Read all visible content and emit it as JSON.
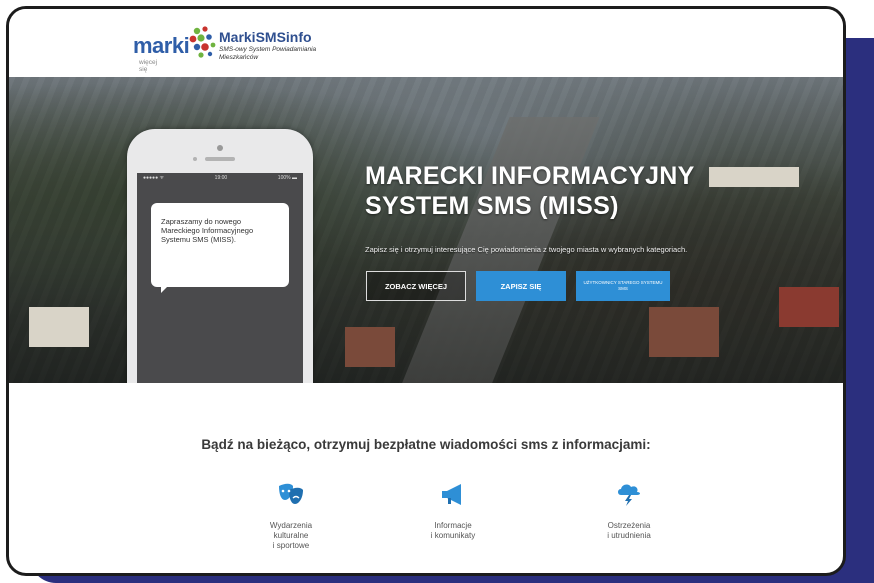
{
  "brand": {
    "logo_word": "marki",
    "logo_tagline": "więcej się",
    "title": "MarkiSMSinfo",
    "subtitle": "SMS-owy System Powiadamiania Mieszkańców"
  },
  "phone": {
    "status_left": "●●●●● ᯤ",
    "status_time": "19:00",
    "status_right": "100% ▬",
    "message": "Zapraszamy do nowego Mareckiego Informacyjnego Systemu SMS (MISS)."
  },
  "hero": {
    "title_line1": "MARECKI INFORMACYJNY",
    "title_line2": "SYSTEM SMS (MISS)",
    "subtitle": "Zapisz się i otrzymuj interesujące Cię powiadomienia z twojego miasta w wybranych kategoriach.",
    "btn_more": "ZOBACZ WIĘCEJ",
    "btn_signup": "ZAPISZ SIĘ",
    "btn_users": "UŻYTKOWNICY STAREGO SYSTEMU SMS"
  },
  "info": {
    "lead": "Bądź na bieżąco, otrzymuj bezpłatne wiadomości sms z informacjami:",
    "features": [
      {
        "icon": "theater-masks-icon",
        "label_lines": [
          "Wydarzenia",
          "kulturalne",
          "i sportowe"
        ]
      },
      {
        "icon": "megaphone-icon",
        "label_lines": [
          "Informacje",
          "i komunikaty"
        ]
      },
      {
        "icon": "storm-cloud-icon",
        "label_lines": [
          "Ostrzeżenia",
          "i utrudnienia"
        ]
      }
    ]
  },
  "colors": {
    "accent": "#2e8fd6",
    "brand": "#2f5ea8",
    "panel": "#2b2f7e"
  }
}
